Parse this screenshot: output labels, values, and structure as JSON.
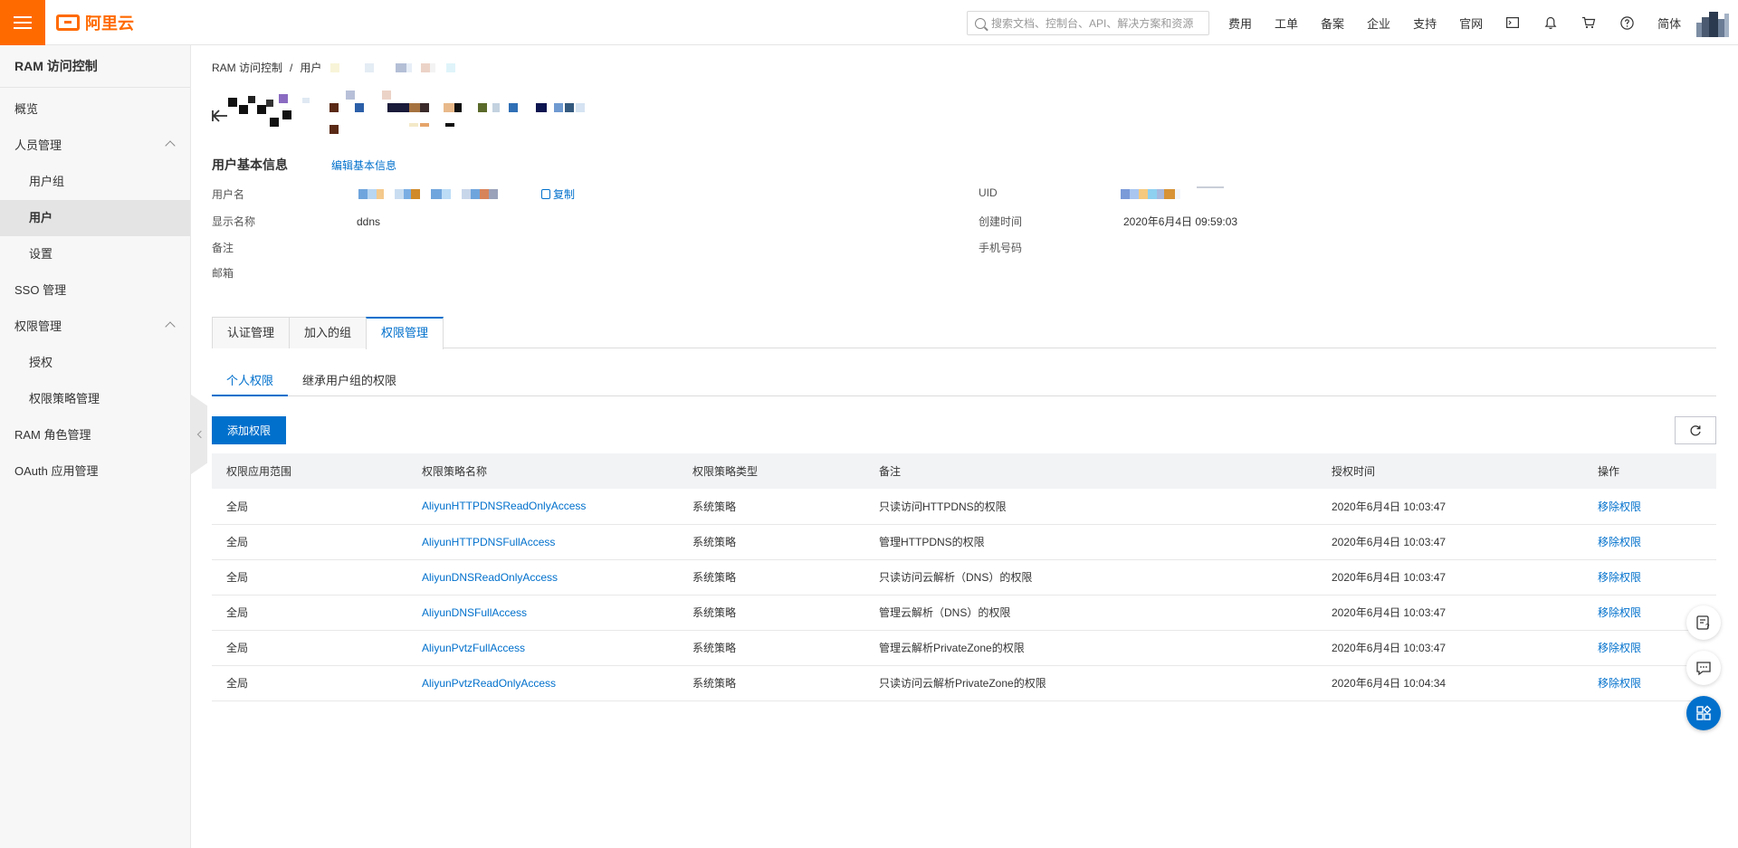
{
  "topbar": {
    "logo_text": "阿里云",
    "search_placeholder": "搜索文档、控制台、API、解决方案和资源",
    "nav_items": [
      "费用",
      "工单",
      "备案",
      "企业",
      "支持",
      "官网"
    ],
    "lang": "简体"
  },
  "sidebar": {
    "title": "RAM 访问控制",
    "items": [
      {
        "label": "概览"
      },
      {
        "label": "人员管理"
      },
      {
        "label": "用户组"
      },
      {
        "label": "用户"
      },
      {
        "label": "设置"
      },
      {
        "label": "SSO 管理"
      },
      {
        "label": "权限管理"
      },
      {
        "label": "授权"
      },
      {
        "label": "权限策略管理"
      },
      {
        "label": "RAM 角色管理"
      },
      {
        "label": "OAuth 应用管理"
      }
    ]
  },
  "breadcrumb": {
    "root": "RAM 访问控制",
    "sep": "/",
    "current": "用户"
  },
  "basic_info": {
    "title": "用户基本信息",
    "edit_link": "编辑基本信息",
    "username_label": "用户名",
    "copy_label": "复制",
    "display_name_label": "显示名称",
    "display_name_value": "ddns",
    "remark_label": "备注",
    "email_label": "邮箱",
    "uid_label": "UID",
    "created_label": "创建时间",
    "created_value": "2020年6月4日 09:59:03",
    "phone_label": "手机号码"
  },
  "tabs": [
    "认证管理",
    "加入的组",
    "权限管理"
  ],
  "subtabs": [
    "个人权限",
    "继承用户组的权限"
  ],
  "actions": {
    "add_permission": "添加权限"
  },
  "table": {
    "headers": [
      "权限应用范围",
      "权限策略名称",
      "权限策略类型",
      "备注",
      "授权时间",
      "操作"
    ],
    "rows": [
      {
        "scope": "全局",
        "policy": "AliyunHTTPDNSReadOnlyAccess",
        "type": "系统策略",
        "note": "只读访问HTTPDNS的权限",
        "time": "2020年6月4日 10:03:47",
        "action": "移除权限"
      },
      {
        "scope": "全局",
        "policy": "AliyunHTTPDNSFullAccess",
        "type": "系统策略",
        "note": "管理HTTPDNS的权限",
        "time": "2020年6月4日 10:03:47",
        "action": "移除权限"
      },
      {
        "scope": "全局",
        "policy": "AliyunDNSReadOnlyAccess",
        "type": "系统策略",
        "note": "只读访问云解析（DNS）的权限",
        "time": "2020年6月4日 10:03:47",
        "action": "移除权限"
      },
      {
        "scope": "全局",
        "policy": "AliyunDNSFullAccess",
        "type": "系统策略",
        "note": "管理云解析（DNS）的权限",
        "time": "2020年6月4日 10:03:47",
        "action": "移除权限"
      },
      {
        "scope": "全局",
        "policy": "AliyunPvtzFullAccess",
        "type": "系统策略",
        "note": "管理云解析PrivateZone的权限",
        "time": "2020年6月4日 10:03:47",
        "action": "移除权限"
      },
      {
        "scope": "全局",
        "policy": "AliyunPvtzReadOnlyAccess",
        "type": "系统策略",
        "note": "只读访问云解析PrivateZone的权限",
        "time": "2020年6月4日 10:04:34",
        "action": "移除权限"
      }
    ]
  },
  "colors": {
    "brand": "#ff6a00",
    "primary": "#0070cc"
  },
  "icons": {
    "floating": [
      "feedback-icon",
      "chat-icon",
      "apps-icon"
    ]
  }
}
